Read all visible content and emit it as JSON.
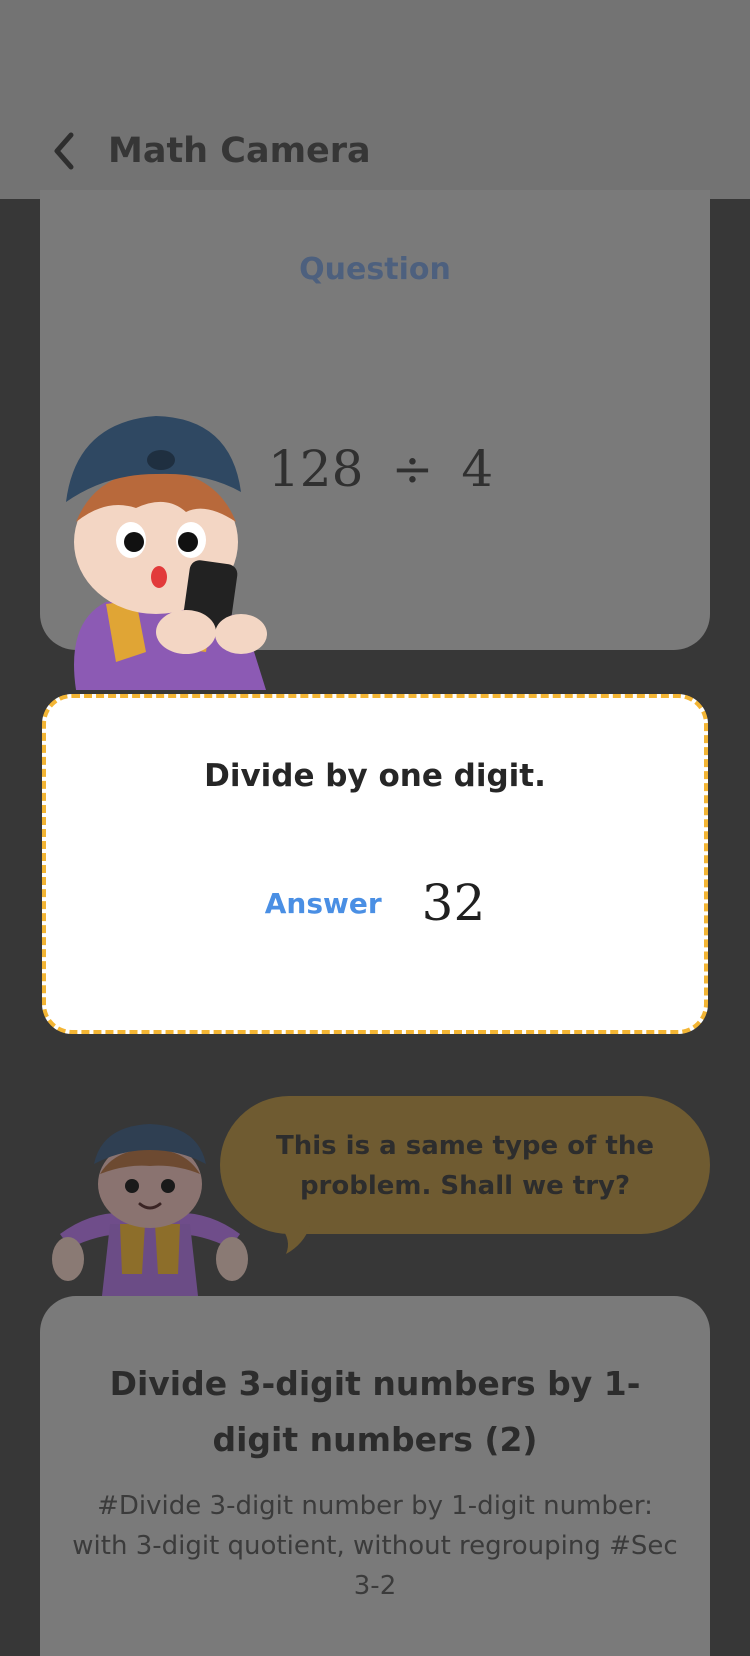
{
  "header": {
    "title": "Math Camera",
    "back_icon": "chevron-left-icon"
  },
  "question_card": {
    "label": "Question",
    "expression": {
      "dividend": "128",
      "operator": "÷",
      "divisor": "4"
    }
  },
  "answer_card": {
    "topic": "Divide by one digit.",
    "answer_label": "Answer",
    "answer_value": "32",
    "border_color": "#f3b534"
  },
  "suggestion": {
    "message": "This is a same type of the problem. Shall we try?"
  },
  "lesson": {
    "title": "Divide 3-digit numbers by 1-digit numbers (2)",
    "tags": "#Divide 3-digit number by 1-digit number: with 3-digit quotient, without regrouping #Sec 3-2"
  },
  "colors": {
    "accent_blue": "#4a8fe4",
    "highlight_yellow": "#f3b534",
    "overlay_dark": "#373737"
  }
}
